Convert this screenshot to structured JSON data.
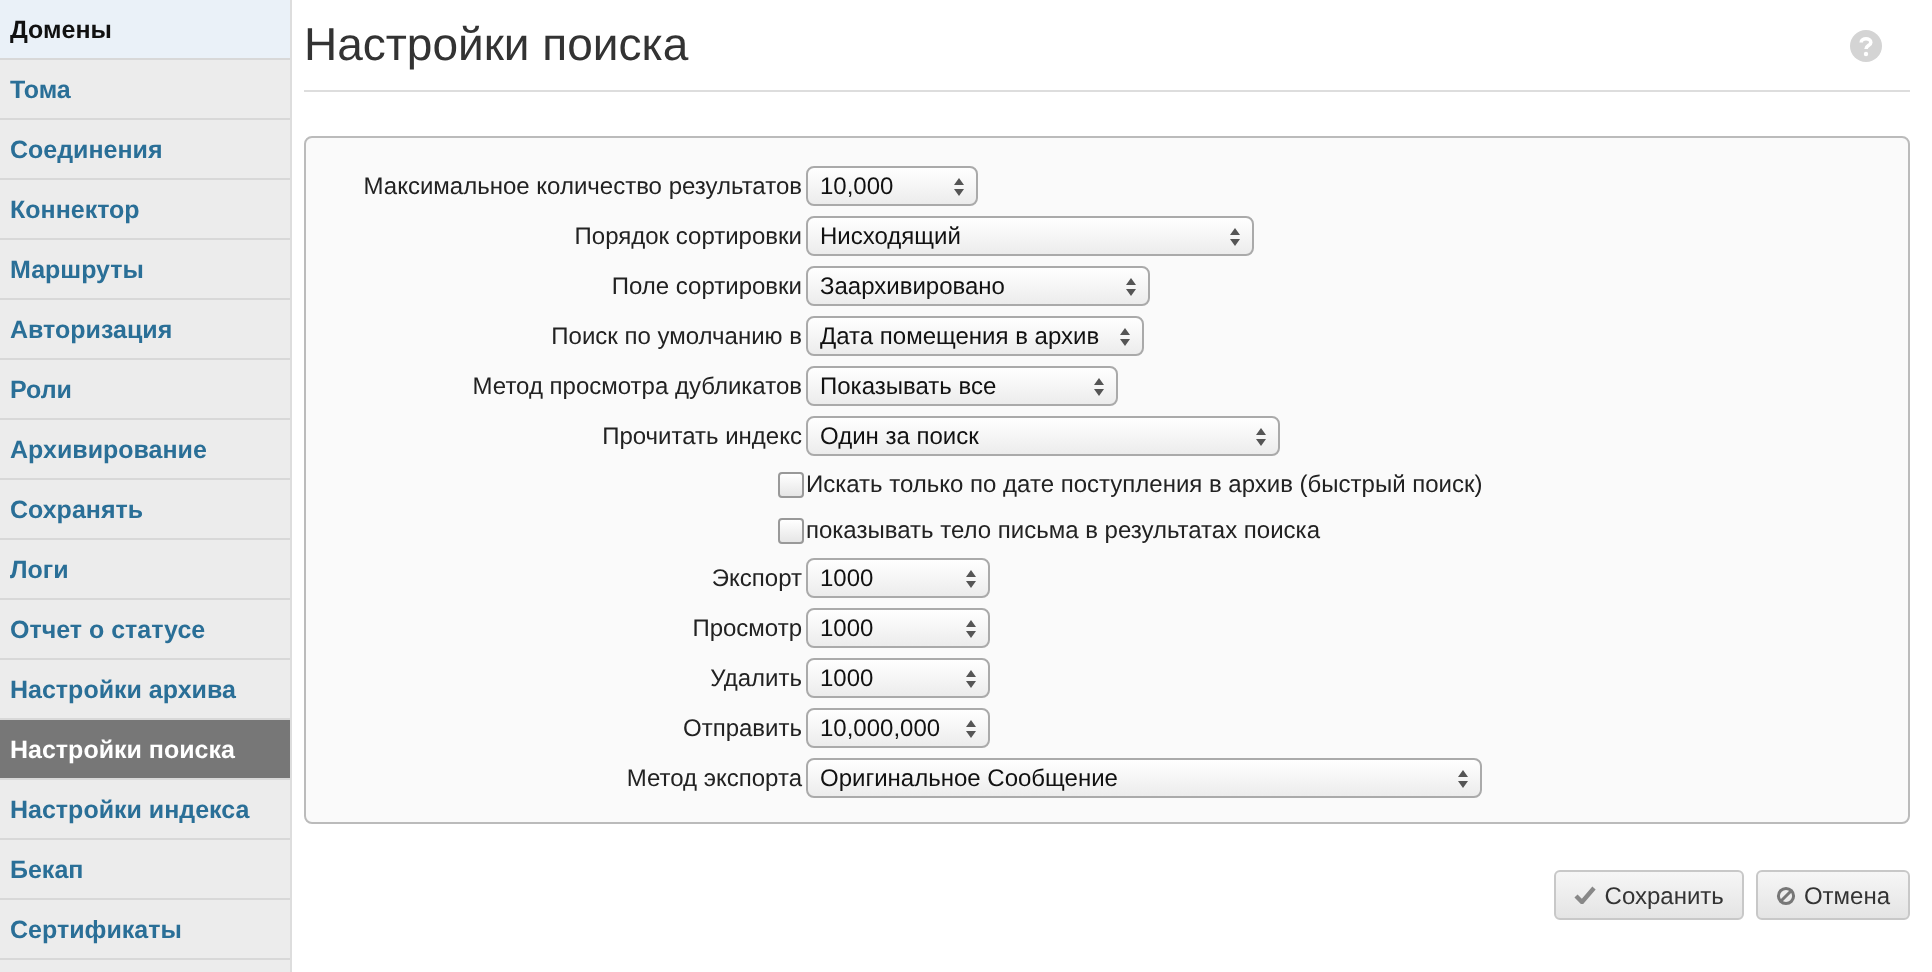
{
  "sidebar": {
    "items": [
      {
        "label": "Домены",
        "kind": "header",
        "selected": false
      },
      {
        "label": "Тома",
        "kind": "link",
        "selected": false
      },
      {
        "label": "Соединения",
        "kind": "link",
        "selected": false
      },
      {
        "label": "Коннектор",
        "kind": "link",
        "selected": false
      },
      {
        "label": "Маршруты",
        "kind": "link",
        "selected": false
      },
      {
        "label": "Авторизация",
        "kind": "link",
        "selected": false
      },
      {
        "label": "Роли",
        "kind": "link",
        "selected": false
      },
      {
        "label": "Архивирование",
        "kind": "link",
        "selected": false
      },
      {
        "label": "Сохранять",
        "kind": "link",
        "selected": false
      },
      {
        "label": "Логи",
        "kind": "link",
        "selected": false
      },
      {
        "label": "Отчет о статусе",
        "kind": "link",
        "selected": false
      },
      {
        "label": "Настройки архива",
        "kind": "link",
        "selected": false
      },
      {
        "label": "Настройки поиска",
        "kind": "link",
        "selected": true
      },
      {
        "label": "Настройки индекса",
        "kind": "link",
        "selected": false
      },
      {
        "label": "Бекап",
        "kind": "link",
        "selected": false
      },
      {
        "label": "Сертификаты",
        "kind": "link",
        "selected": false
      }
    ]
  },
  "page": {
    "title": "Настройки поиска"
  },
  "form": {
    "rows": [
      {
        "kind": "select",
        "label": "Максимальное количество результатов",
        "value": "10,000"
      },
      {
        "kind": "select",
        "label": "Порядок сортировки",
        "value": "Нисходящий"
      },
      {
        "kind": "select",
        "label": "Поле сортировки",
        "value": "Заархивировано"
      },
      {
        "kind": "select",
        "label": "Поиск по умолчанию в",
        "value": "Дата помещения в архив"
      },
      {
        "kind": "select",
        "label": "Метод просмотра дубликатов",
        "value": "Показывать все"
      },
      {
        "kind": "select",
        "label": "Прочитать индекс",
        "value": "Один за поиск"
      },
      {
        "kind": "checkbox",
        "label": "Искать только по дате поступления в архив (быстрый поиск)",
        "checked": false
      },
      {
        "kind": "checkbox",
        "label": "показывать тело письма в результатах поиска",
        "checked": false
      },
      {
        "kind": "select",
        "label": "Экспорт",
        "value": "1000"
      },
      {
        "kind": "select",
        "label": "Просмотр",
        "value": "1000"
      },
      {
        "kind": "select",
        "label": "Удалить",
        "value": "1000"
      },
      {
        "kind": "select",
        "label": "Отправить",
        "value": "10,000,000"
      },
      {
        "kind": "select",
        "label": "Метод экспорта",
        "value": "Оригинальное Сообщение"
      }
    ]
  },
  "buttons": [
    {
      "label": "Сохранить",
      "kind": "save"
    },
    {
      "label": "Отмена",
      "kind": "cancel"
    }
  ]
}
